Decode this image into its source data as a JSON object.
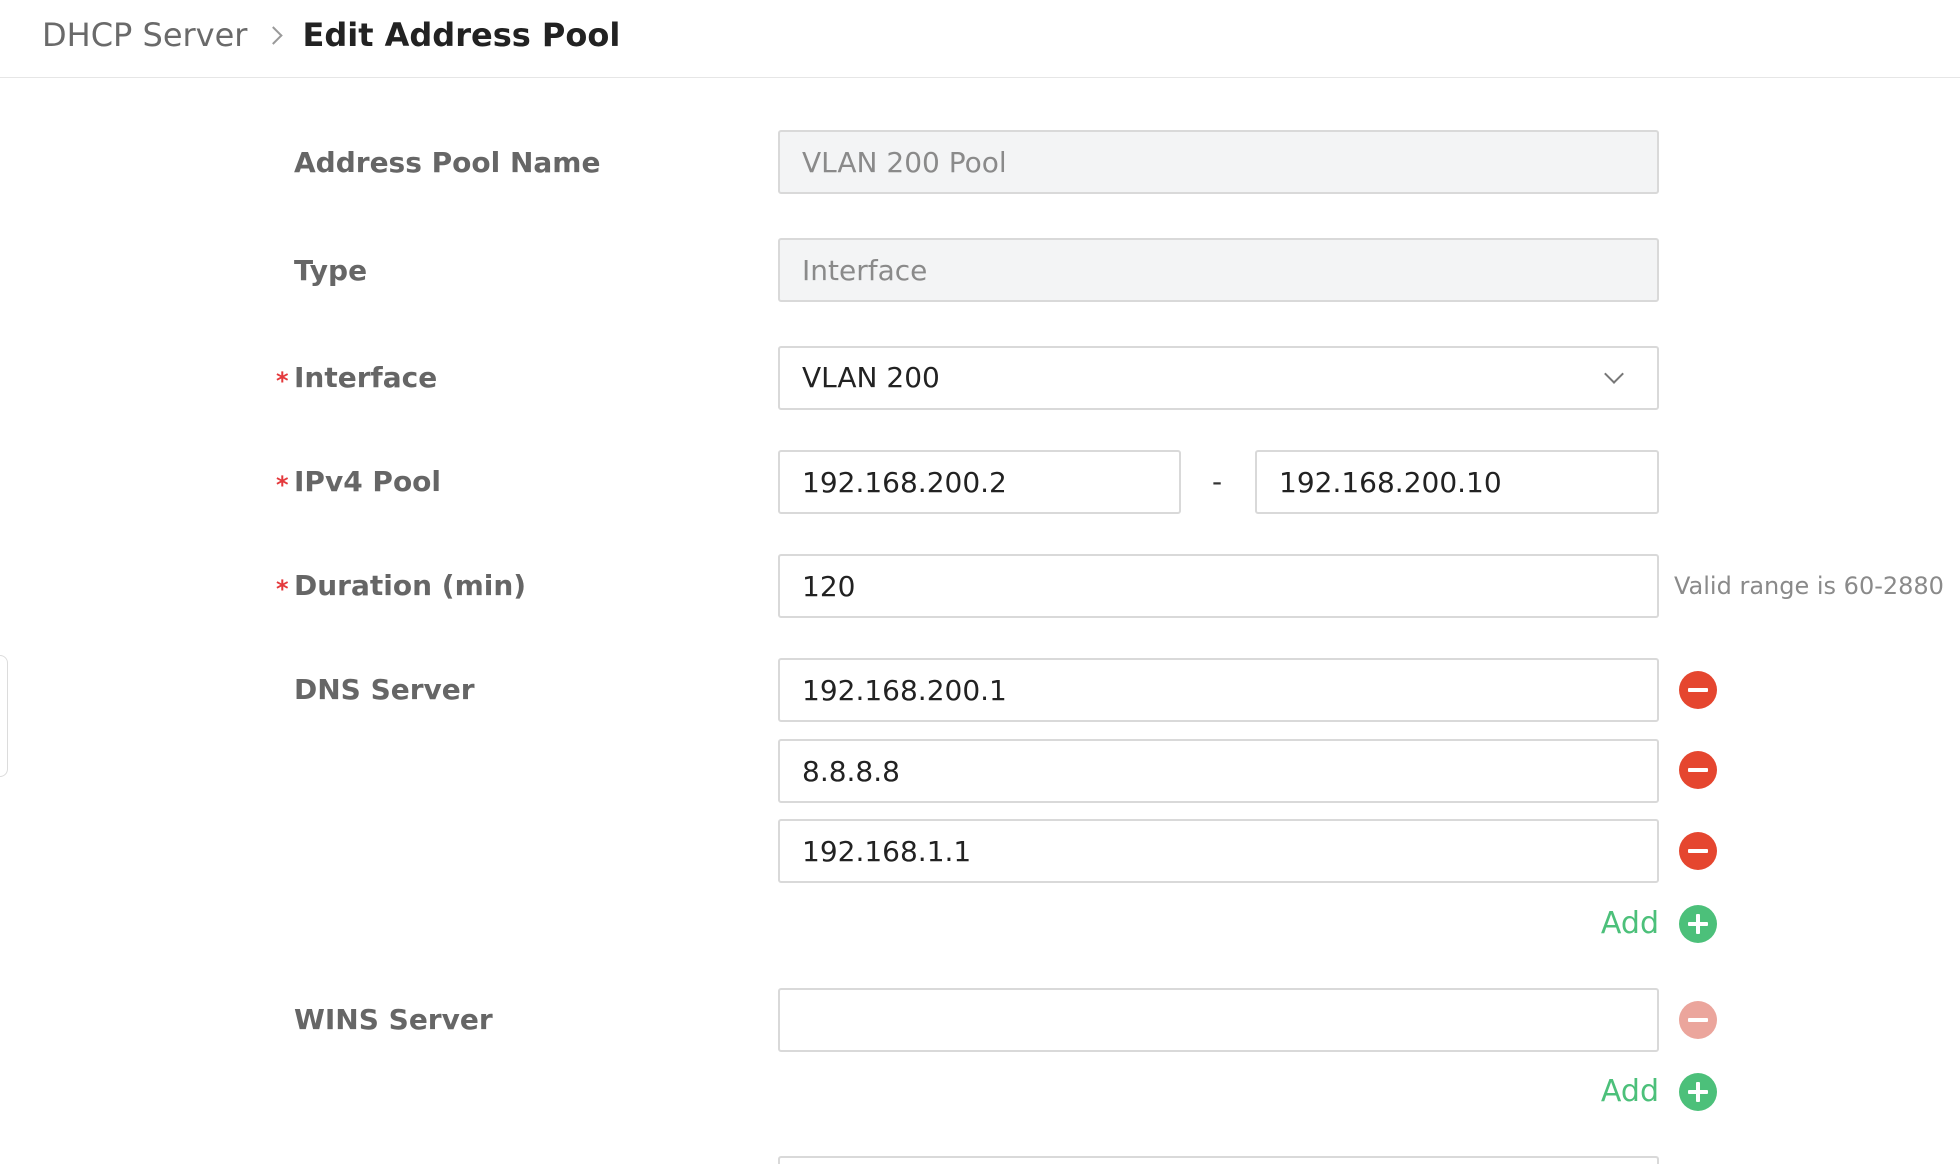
{
  "breadcrumb": {
    "parent": "DHCP Server",
    "current": "Edit Address Pool"
  },
  "form": {
    "pool_name": {
      "label": "Address Pool Name",
      "value": "VLAN 200 Pool"
    },
    "type": {
      "label": "Type",
      "value": "Interface"
    },
    "interface": {
      "label": "Interface",
      "required": "*",
      "value": "VLAN 200"
    },
    "ipv4_pool": {
      "label": "IPv4 Pool",
      "required": "*",
      "start": "192.168.200.2",
      "separator": "-",
      "end": "192.168.200.10"
    },
    "duration": {
      "label": "Duration (min)",
      "required": "*",
      "value": "120",
      "hint": "Valid range is 60-2880"
    },
    "dns_server": {
      "label": "DNS Server",
      "entries": [
        "192.168.200.1",
        "8.8.8.8",
        "192.168.1.1"
      ],
      "add_label": "Add"
    },
    "wins_server": {
      "label": "WINS Server",
      "entries": [
        ""
      ],
      "add_label": "Add"
    }
  },
  "colors": {
    "required": "#e4393c",
    "remove": "#e5462f",
    "remove_disabled": "#eba59c",
    "add": "#4cc07a"
  },
  "icons": {
    "breadcrumb_separator": "chevron-right-icon",
    "select_arrow": "chevron-down-icon",
    "remove": "minus-circle-icon",
    "add": "plus-circle-icon"
  }
}
